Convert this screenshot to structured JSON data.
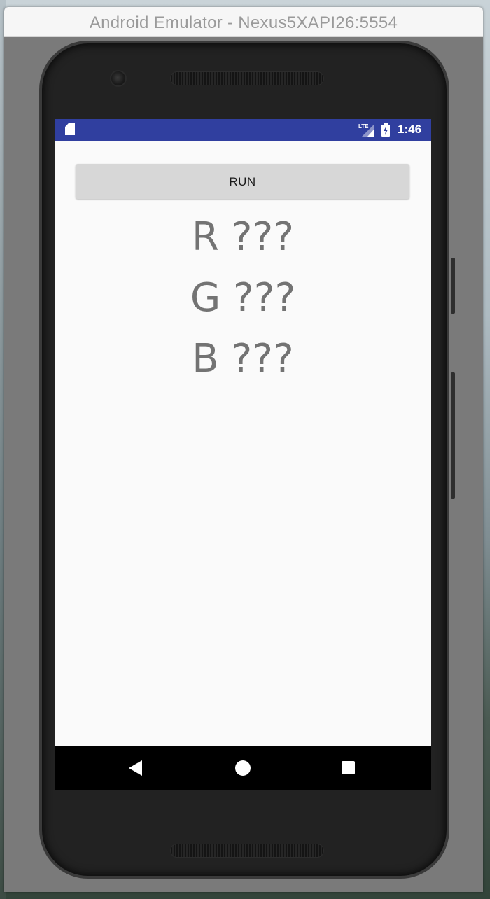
{
  "window": {
    "title": "Android Emulator - Nexus5XAPI26:5554"
  },
  "status_bar": {
    "network_label": "LTE",
    "time": "1:46",
    "color": "#303f9f"
  },
  "app": {
    "run_button_label": "RUN",
    "values": {
      "r": "R ???",
      "g": "G ???",
      "b": "B ???"
    }
  },
  "nav_bar": {
    "icons": [
      "back-icon",
      "home-icon",
      "recents-icon"
    ]
  }
}
